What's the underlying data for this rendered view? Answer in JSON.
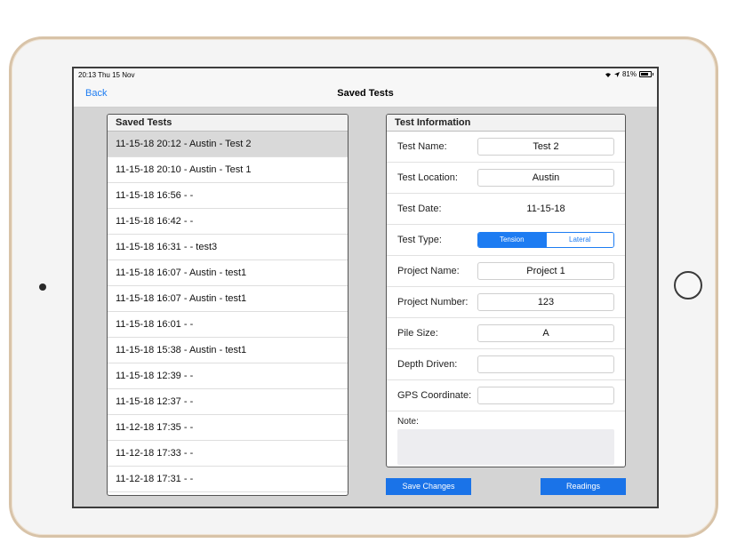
{
  "status_bar": {
    "time_date": "20:13  Thu 15 Nov",
    "battery": "81%",
    "battery_level": 0.81
  },
  "nav": {
    "back_label": "Back",
    "title": "Saved Tests"
  },
  "saved_tests": {
    "header": "Saved Tests",
    "items": [
      "11-15-18 20:12 - Austin  - Test 2",
      "11-15-18 20:10 - Austin  - Test 1",
      "11-15-18 16:56 -  -",
      "11-15-18 16:42 -  -",
      "11-15-18 16:31 -  - test3",
      "11-15-18 16:07 - Austin  - test1",
      "11-15-18 16:07 - Austin  - test1",
      "11-15-18 16:01 -  -",
      "11-15-18 15:38 - Austin  - test1",
      "11-15-18 12:39 -  -",
      "11-15-18 12:37 -  -",
      "11-12-18 17:35 -  -",
      "11-12-18 17:33 -  -",
      "11-12-18 17:31 -  -"
    ],
    "selected_index": 0
  },
  "test_info": {
    "header": "Test Information",
    "test_name": {
      "label": "Test Name:",
      "value": "Test 2"
    },
    "test_location": {
      "label": "Test Location:",
      "value": "Austin"
    },
    "test_date": {
      "label": "Test Date:",
      "value": "11-15-18"
    },
    "test_type": {
      "label": "Test Type:",
      "options": [
        "Tension",
        "Lateral"
      ],
      "selected": "Tension"
    },
    "project_name": {
      "label": "Project Name:",
      "value": "Project 1"
    },
    "project_number": {
      "label": "Project Number:",
      "value": "123"
    },
    "pile_size": {
      "label": "Pile Size:",
      "value": "A"
    },
    "depth_driven": {
      "label": "Depth Driven:",
      "value": ""
    },
    "gps_coordinate": {
      "label": "GPS Coordinate:",
      "value": ""
    },
    "note": {
      "label": "Note:",
      "value": ""
    }
  },
  "buttons": {
    "save_changes": "Save Changes",
    "readings": "Readings"
  },
  "colors": {
    "accent": "#1d7cf2",
    "button": "#1a73e8",
    "device_frame": "#d8c3a8"
  }
}
